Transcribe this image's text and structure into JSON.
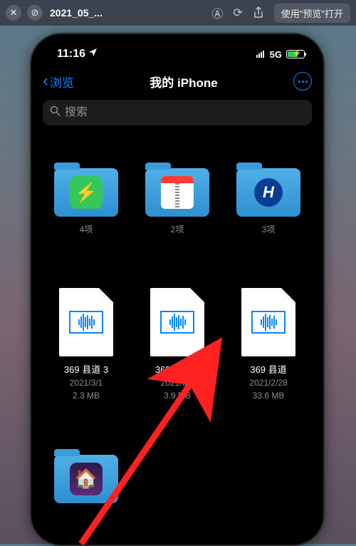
{
  "toolbar": {
    "title": "2021_05_...",
    "open_with": "使用\"预览\"打开"
  },
  "status": {
    "time": "11:16",
    "network": "5G"
  },
  "nav": {
    "back_label": "浏览",
    "title": "我的 iPhone"
  },
  "search": {
    "placeholder": "搜索"
  },
  "grid": {
    "folders": [
      {
        "name": "",
        "sub": "4项"
      },
      {
        "name": "",
        "sub": "2项"
      },
      {
        "name": "",
        "sub": "3项"
      }
    ],
    "files": [
      {
        "name": "369 县道 3",
        "date": "2021/3/1",
        "size": "2.3 MB"
      },
      {
        "name": "369 县道 2",
        "date": "2021/3/1",
        "size": "3.9 MB"
      },
      {
        "name": "369 县道",
        "date": "2021/2/28",
        "size": "33.6 MB"
      }
    ]
  }
}
